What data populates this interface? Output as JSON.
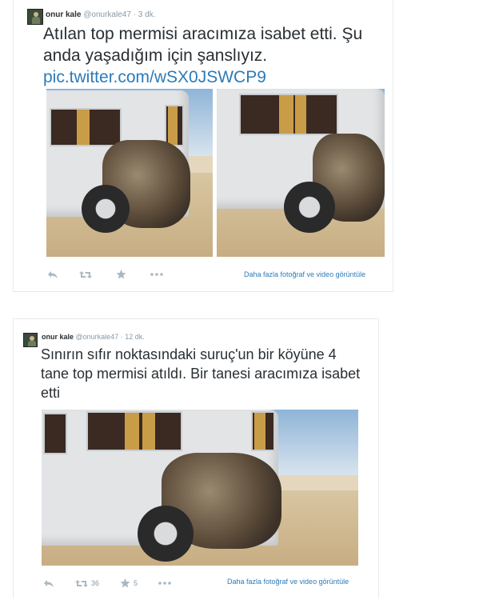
{
  "tweets": [
    {
      "name": "onur kale",
      "handle": "@onurkale47",
      "dot": "·",
      "time": "3 dk.",
      "text": "Atılan top mermisi aracımıza isabet etti. Şu anda yaşadığım için şanslıyız.",
      "link": "pic.twitter.com/wSX0JSWCP9",
      "actions": {
        "reply_icon": "reply-icon",
        "retweet_icon": "retweet-icon",
        "favorite_icon": "star-icon",
        "more_icon": "more-icon",
        "retweets": "",
        "favorites": ""
      },
      "more_media": "Daha fazla fotoğraf ve video görüntüle"
    },
    {
      "name": "onur kale",
      "handle": "@onurkale47",
      "dot": "·",
      "time": "12 dk.",
      "text": "Sınırın sıfır noktasındaki suruç'un bir köyüne 4 tane top mermisi atıldı. Bir tanesi aracımıza isabet etti",
      "actions": {
        "reply_icon": "reply-icon",
        "retweet_icon": "retweet-icon",
        "favorite_icon": "star-icon",
        "more_icon": "more-icon",
        "retweets": "36",
        "favorites": "5"
      },
      "more_media": "Daha fazla fotoğraf ve video görüntüle"
    }
  ],
  "colors": {
    "link": "#2b7bb9",
    "text": "#292f33",
    "muted": "#8899a6",
    "icon": "#aab8c2"
  }
}
